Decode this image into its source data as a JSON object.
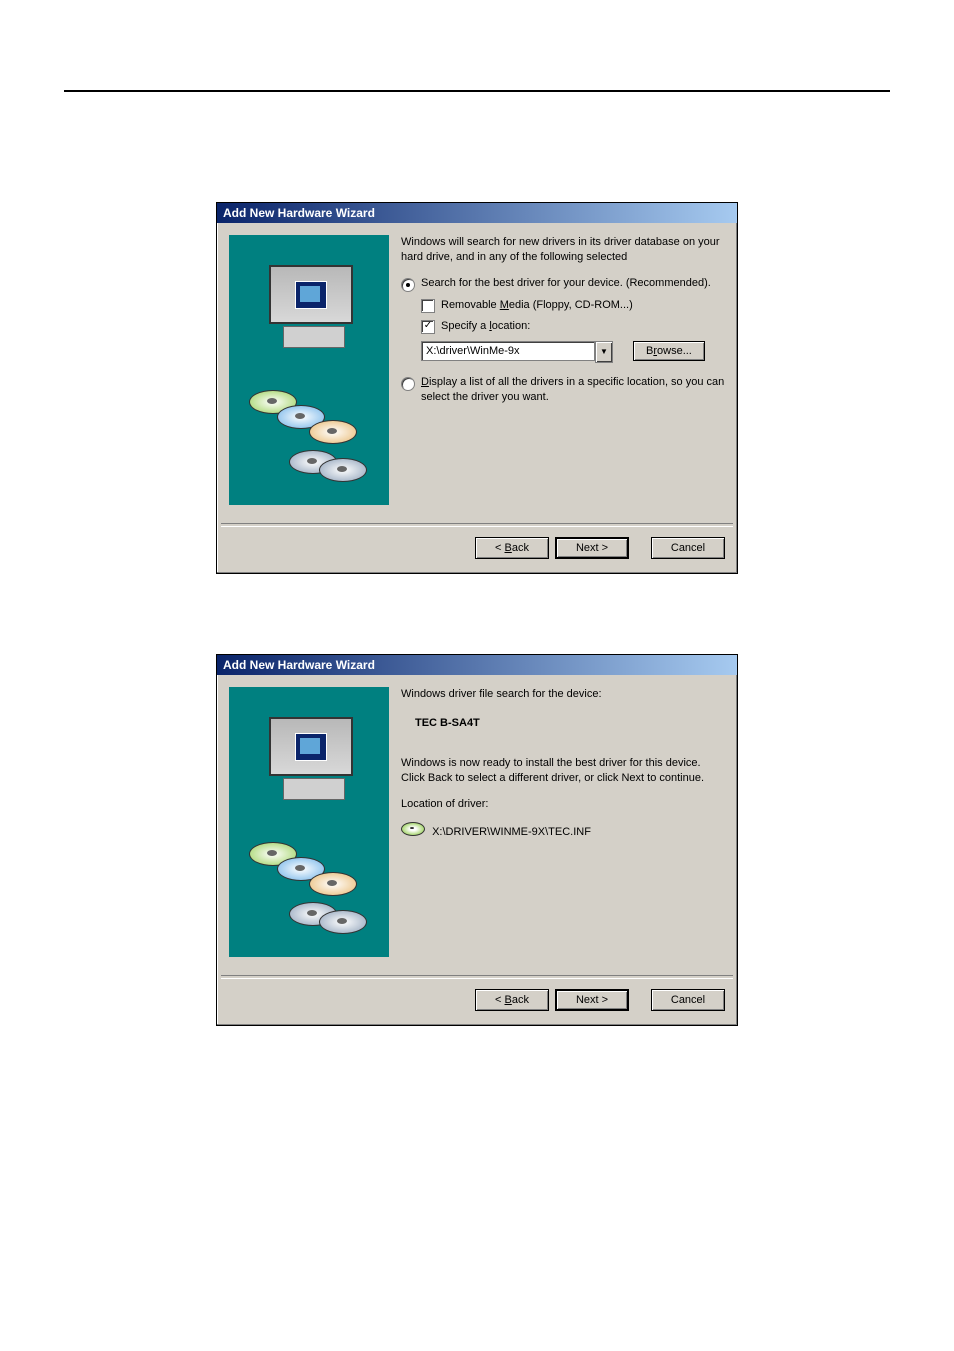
{
  "dialog1": {
    "title": "Add New Hardware Wizard",
    "intro": "Windows will search for new drivers in its driver database on your hard drive, and in any of the following selected",
    "option_search": "Search for the best driver for your device. (Recommended).",
    "check_removable": "Removable Media (Floppy, CD-ROM...)",
    "check_specify": "Specify a location:",
    "location_value": "X:\\driver\\WinMe-9x",
    "browse_button": "Browse...",
    "option_display": "Display a list of all the drivers in a specific location, so you can select the driver you want.",
    "back": "< Back",
    "next": "Next >",
    "cancel": "Cancel"
  },
  "dialog2": {
    "title": "Add New Hardware Wizard",
    "search_label": "Windows driver file search for the device:",
    "device_name": "TEC B-SA4T",
    "ready_text": "Windows is now ready to install the best driver for this device. Click Back to select a different driver, or click Next to continue.",
    "location_label": "Location of driver:",
    "driver_path": "X:\\DRIVER\\WINME-9X\\TEC.INF",
    "back": "< Back",
    "next": "Next >",
    "cancel": "Cancel"
  }
}
